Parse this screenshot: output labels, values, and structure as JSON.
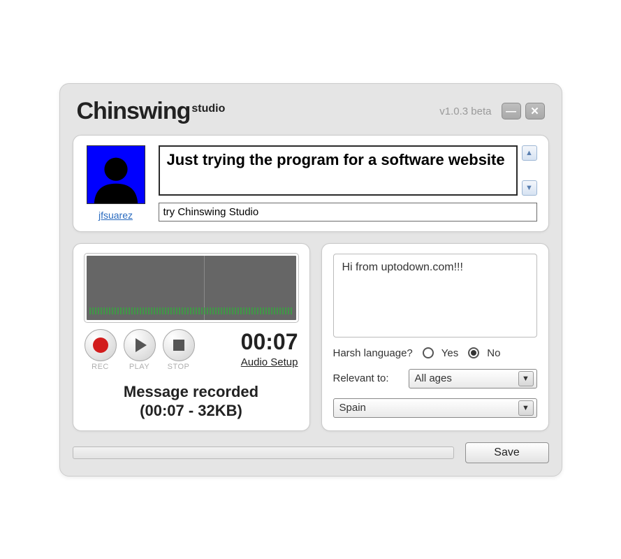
{
  "header": {
    "brand_main": "Chinswing",
    "brand_sub": "studio",
    "version": "v1.0.3 beta",
    "minimize_glyph": "—",
    "close_glyph": "✕"
  },
  "user": {
    "username": "jfsuarez"
  },
  "post": {
    "title": "Just trying the program for a software website",
    "tag": "try Chinswing Studio"
  },
  "recorder": {
    "rec_label": "REC",
    "play_label": "PLAY",
    "stop_label": "STOP",
    "time": "00:07",
    "audio_setup": "Audio Setup",
    "status_line1": "Message recorded",
    "status_line2": "(00:07 - 32KB)"
  },
  "meta": {
    "description": "Hi from uptodown.com!!!",
    "harsh_label": "Harsh language?",
    "yes": "Yes",
    "no": "No",
    "harsh_selected": "No",
    "relevant_label": "Relevant to:",
    "relevant_value": "All ages",
    "country_value": "Spain"
  },
  "footer": {
    "save": "Save"
  }
}
